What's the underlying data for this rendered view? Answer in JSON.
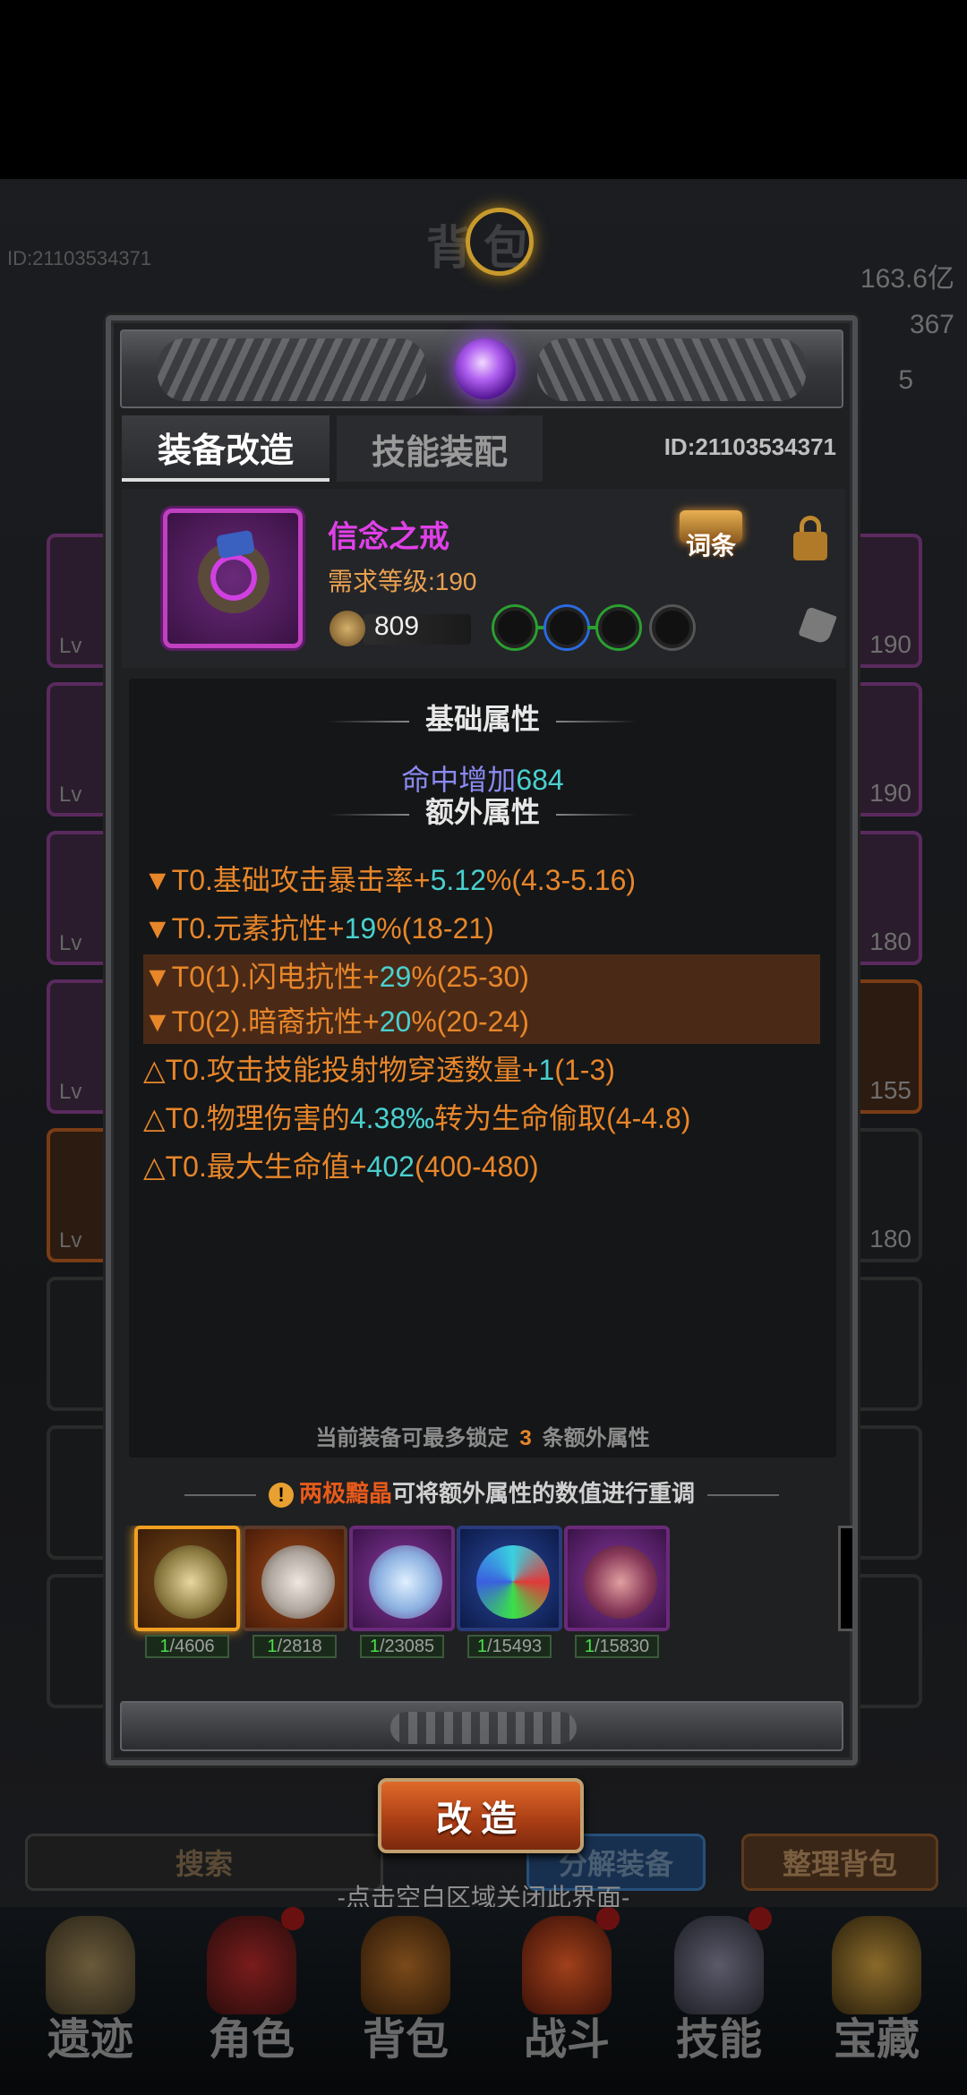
{
  "background": {
    "title": "背包",
    "player_id": "ID:21103534371",
    "resources": [
      "163.6亿",
      "367",
      "5"
    ],
    "left_slots": [
      "Lv",
      "Lv",
      "Lv",
      "Lv",
      "Lv"
    ],
    "right_slots": [
      "190",
      "190",
      "180",
      "155",
      "180"
    ],
    "search_label": "搜索",
    "decompose_label": "分解装备",
    "sort_label": "整理背包",
    "close_hint": "-点击空白区域关闭此界面-"
  },
  "nav": {
    "items": [
      {
        "label": "遗迹"
      },
      {
        "label": "角色"
      },
      {
        "label": "背包"
      },
      {
        "label": "战斗"
      },
      {
        "label": "技能"
      },
      {
        "label": "宝藏"
      }
    ]
  },
  "modal": {
    "tabs": [
      "装备改造",
      "技能装配"
    ],
    "id": "ID:21103534371",
    "item": {
      "name": "信念之戒",
      "level_req": "需求等级:190",
      "power": "809"
    },
    "affix_button": "词条",
    "base_title": "基础属性",
    "base_attr_label": "命中增加",
    "base_attr_value": "684",
    "extra_title": "额外属性",
    "affixes": [
      {
        "pre": "▼T0.基础攻击暴击率+",
        "val": "5.12",
        "post": "%(4.3-5.16)",
        "highlight": false
      },
      {
        "pre": "▼T0.元素抗性+",
        "val": "19",
        "post": "%(18-21)",
        "highlight": false
      },
      {
        "pre": "▼T0(1).闪电抗性+",
        "val": "29",
        "post": "%(25-30)",
        "highlight": true
      },
      {
        "pre": "▼T0(2).暗裔抗性+",
        "val": "20",
        "post": "%(20-24)",
        "highlight": true
      },
      {
        "pre": "△T0.攻击技能投射物穿透数量+",
        "val": "1",
        "post": "(1-3)",
        "highlight": false
      },
      {
        "pre": "△T0.物理伤害的",
        "val": "4.38‰",
        "post": "转为生命偷取(4-4.8)",
        "highlight": false
      },
      {
        "pre": "△T0.最大生命值+",
        "val": "402",
        "post": "(400-480)",
        "highlight": false
      }
    ],
    "lock_info_pre": "当前装备可最多锁定",
    "lock_info_num": "3",
    "lock_info_post": "条额外属性",
    "reforge_hint_warn": "!",
    "reforge_hint_item": "两极黯晶",
    "reforge_hint_text": "可将额外属性的数值进行重调",
    "materials": [
      {
        "have": "1",
        "total": "/4606",
        "selected": true
      },
      {
        "have": "1",
        "total": "/2818",
        "selected": false
      },
      {
        "have": "1",
        "total": "/23085",
        "selected": false
      },
      {
        "have": "1",
        "total": "/15493",
        "selected": false
      },
      {
        "have": "1",
        "total": "/15830",
        "selected": false
      }
    ],
    "reforge_button": "改造"
  },
  "colors": {
    "affix_orange": "#e8862a",
    "value_cyan": "#4ad0d0",
    "item_purple": "#e040e8",
    "highlight_row": "#4a2a16"
  }
}
